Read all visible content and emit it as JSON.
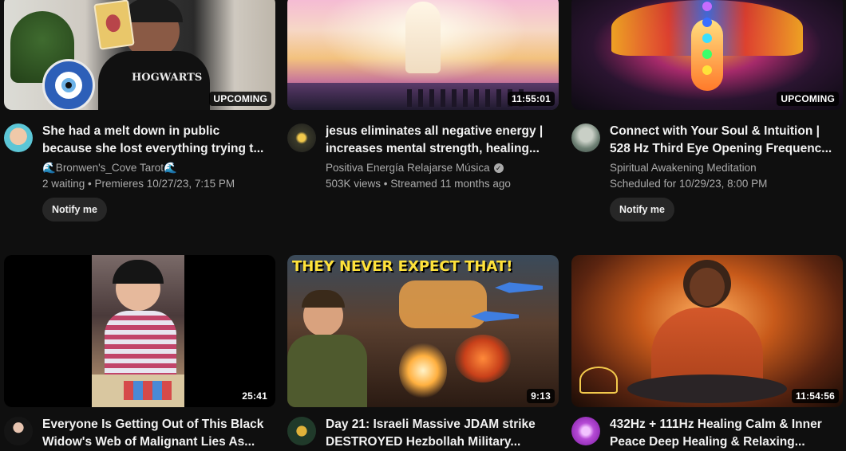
{
  "videos": [
    {
      "title": "She had a melt down in public because she lost everything trying t...",
      "channel": "🌊Bronwen's_Cove Tarot🌊",
      "meta": "2 waiting • Premieres 10/27/23, 7:15 PM",
      "badge": "UPCOMING",
      "button": "Notify me",
      "thumb_text": "HOGWARTS"
    },
    {
      "title": "jesus eliminates all negative energy | increases mental strength, healing...",
      "channel": "Positiva Energía Relajarse Música",
      "meta": "503K views • Streamed 11 months ago",
      "badge": "11:55:01"
    },
    {
      "title": "Connect with Your Soul & Intuition | 528 Hz Third Eye Opening Frequenc...",
      "channel": "Spiritual Awakening Meditation",
      "meta": "Scheduled for 10/29/23, 8:00 PM",
      "badge": "UPCOMING",
      "button": "Notify me"
    },
    {
      "title": "Everyone Is Getting Out of This Black Widow's Web of Malignant Lies As...",
      "badge": "25:41"
    },
    {
      "title": "Day 21: Israeli Massive JDAM strike DESTROYED Hezbollah Military...",
      "badge": "9:13",
      "thumb_text": "THEY NEVER EXPECT THAT!"
    },
    {
      "title": "432Hz + 111Hz Healing Calm & Inner Peace Deep Healing & Relaxing...",
      "badge": "11:54:56"
    }
  ]
}
